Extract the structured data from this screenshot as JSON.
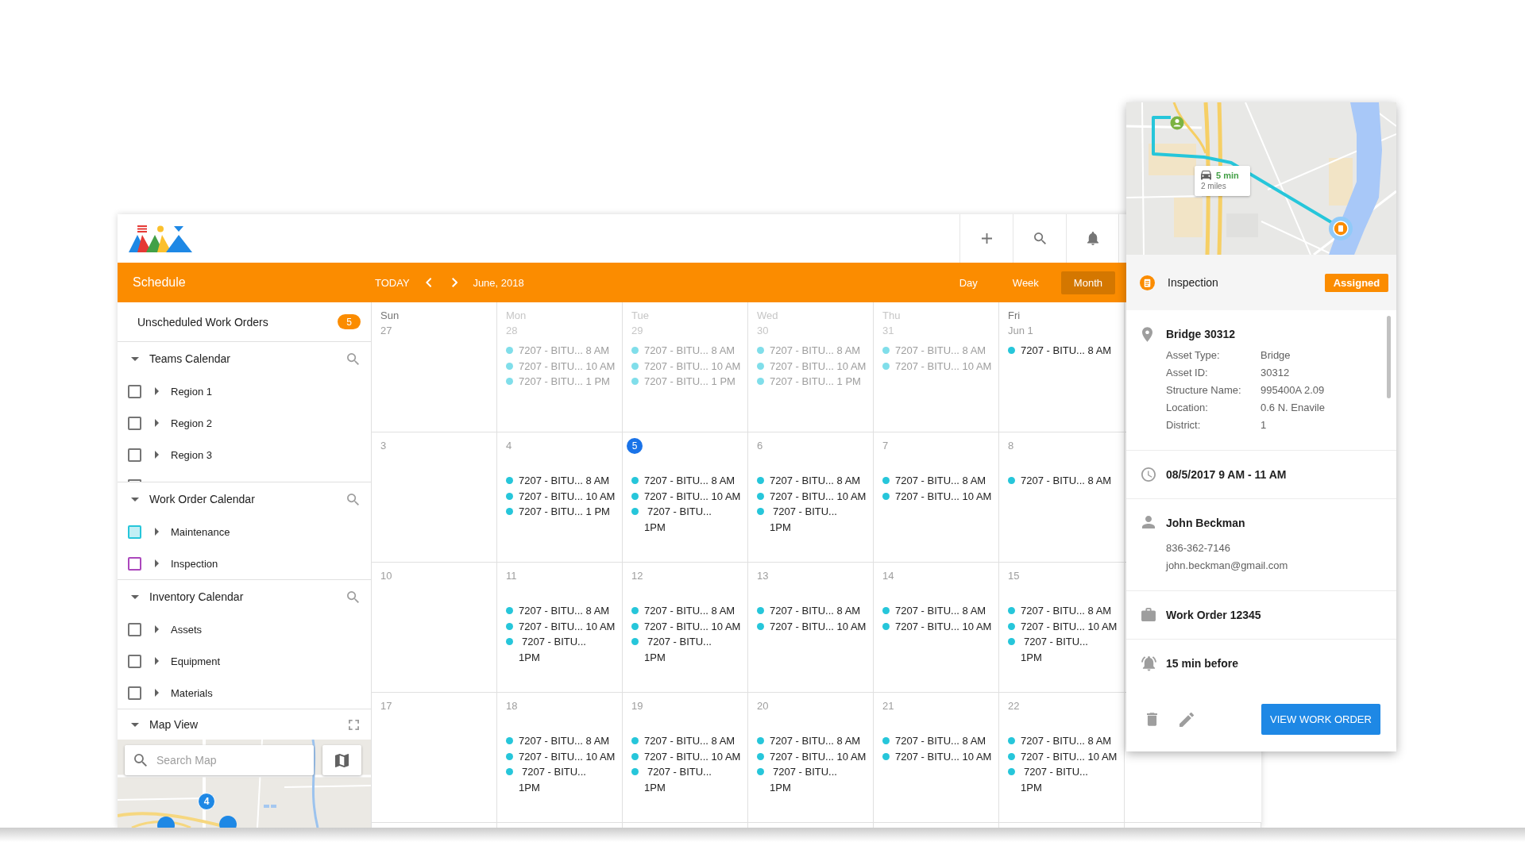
{
  "toolbar": {
    "title": "Schedule",
    "today": "TODAY",
    "period": "June, 2018",
    "views": [
      {
        "label": "Day",
        "selected": false
      },
      {
        "label": "Week",
        "selected": false
      },
      {
        "label": "Month",
        "selected": true
      }
    ]
  },
  "sidebar": {
    "unscheduled": {
      "label": "Unscheduled Work Orders",
      "count": "5"
    },
    "sections": [
      {
        "title": "Teams Calendar",
        "expanded": true,
        "items": [
          {
            "label": "Region 1",
            "checked": false,
            "expanded": false
          },
          {
            "label": "Region 2",
            "checked": false,
            "expanded": false
          },
          {
            "label": "Region 3",
            "checked": false,
            "expanded": false
          },
          {
            "checked": false
          }
        ]
      },
      {
        "title": "Work Order Calendar",
        "expanded": true,
        "items": [
          {
            "label": "Maintenance",
            "checked": true,
            "expanded": false,
            "color": "#26c6da"
          },
          {
            "label": "Inspection",
            "checked": false,
            "expanded": false,
            "color": "#ab47bc"
          }
        ]
      },
      {
        "title": "Inventory Calendar",
        "expanded": true,
        "items": [
          {
            "label": "Assets",
            "checked": false,
            "expanded": false
          },
          {
            "label": "Equipment",
            "checked": false,
            "expanded": false
          },
          {
            "label": "Materials",
            "checked": false,
            "expanded": false
          }
        ]
      }
    ],
    "map_view": {
      "title": "Map View",
      "expanded": true,
      "search": {
        "placeholder": "Search Map"
      },
      "markers": [
        {
          "label": "4"
        }
      ]
    }
  },
  "calendar": {
    "weeks": [
      {
        "days": [
          {
            "weekday": "Sun",
            "date": "27",
            "muted": false,
            "today": false
          },
          {
            "weekday": "Mon",
            "date": "28",
            "muted": true,
            "today": false,
            "events": [
              {
                "kind": "inline",
                "title": "7207 - BITU...",
                "time": "8 AM"
              },
              {
                "kind": "inline",
                "title": "7207 - BITU...",
                "time": "10 AM"
              },
              {
                "kind": "inline",
                "title": "7207 - BITU...",
                "time": "1 PM"
              }
            ]
          },
          {
            "weekday": "Tue",
            "date": "29",
            "muted": true,
            "today": false,
            "events": [
              {
                "kind": "inline",
                "title": "7207 - BITU...",
                "time": "8 AM"
              },
              {
                "kind": "inline",
                "title": "7207 - BITU...",
                "time": "10 AM"
              },
              {
                "kind": "inline",
                "title": "7207 - BITU...",
                "time": "1 PM"
              }
            ]
          },
          {
            "weekday": "Wed",
            "date": "30",
            "muted": true,
            "today": false,
            "events": [
              {
                "kind": "inline",
                "title": "7207 - BITU...",
                "time": "8 AM"
              },
              {
                "kind": "inline",
                "title": "7207 - BITU...",
                "time": "10 AM"
              },
              {
                "kind": "inline",
                "title": "7207 - BITU...",
                "time": "1 PM"
              }
            ]
          },
          {
            "weekday": "Thu",
            "date": "31",
            "muted": true,
            "today": false,
            "events": [
              {
                "kind": "inline",
                "title": "7207 - BITU...",
                "time": "8 AM"
              },
              {
                "kind": "inline",
                "title": "7207 - BITU...",
                "time": "10 AM"
              }
            ]
          },
          {
            "weekday": "Fri",
            "date": "Jun 1",
            "muted": false,
            "today": false,
            "events": [
              {
                "kind": "inline",
                "title": "7207 - BITU...",
                "time": "8 AM"
              }
            ]
          }
        ]
      },
      {
        "days": [
          {
            "date": "3",
            "muted": false,
            "today": false
          },
          {
            "date": "4",
            "muted": false,
            "today": false,
            "events": [
              {
                "kind": "inline",
                "title": "7207 - BITU...",
                "time": "8 AM"
              },
              {
                "kind": "inline",
                "title": "7207 - BITU...",
                "time": "10 AM"
              },
              {
                "kind": "inline",
                "title": "7207 - BITU...",
                "time": "1 PM"
              }
            ]
          },
          {
            "date": "5",
            "muted": false,
            "today": true,
            "events": [
              {
                "kind": "inline",
                "title": "7207 - BITU...",
                "time": "8 AM"
              },
              {
                "kind": "inline",
                "title": "7207 - BITU...",
                "time": "10 AM"
              },
              {
                "kind": "wrapped",
                "title": "7207 - BITU...",
                "time": "1PM"
              }
            ]
          },
          {
            "date": "6",
            "muted": false,
            "today": false,
            "events": [
              {
                "kind": "inline",
                "title": "7207 - BITU...",
                "time": "8 AM"
              },
              {
                "kind": "inline",
                "title": "7207 - BITU...",
                "time": "10 AM"
              },
              {
                "kind": "wrapped",
                "title": "7207 - BITU...",
                "time": "1PM"
              }
            ]
          },
          {
            "date": "7",
            "muted": false,
            "today": false,
            "events": [
              {
                "kind": "inline",
                "title": "7207 - BITU...",
                "time": "8 AM"
              },
              {
                "kind": "inline",
                "title": "7207 - BITU...",
                "time": "10 AM"
              }
            ]
          },
          {
            "date": "8",
            "muted": false,
            "today": false,
            "events": [
              {
                "kind": "inline",
                "title": "7207 - BITU...",
                "time": "8 AM"
              }
            ]
          }
        ]
      },
      {
        "days": [
          {
            "date": "10",
            "muted": false,
            "today": false
          },
          {
            "date": "11",
            "muted": false,
            "today": false,
            "events": [
              {
                "kind": "inline",
                "title": "7207 - BITU...",
                "time": "8 AM"
              },
              {
                "kind": "inline",
                "title": "7207 - BITU...",
                "time": "10 AM"
              },
              {
                "kind": "wrapped",
                "title": "7207 - BITU...",
                "time": "1PM"
              }
            ]
          },
          {
            "date": "12",
            "muted": false,
            "today": false,
            "events": [
              {
                "kind": "inline",
                "title": "7207 - BITU...",
                "time": "8 AM"
              },
              {
                "kind": "inline",
                "title": "7207 - BITU...",
                "time": "10 AM"
              },
              {
                "kind": "wrapped",
                "title": "7207 - BITU...",
                "time": "1PM"
              }
            ]
          },
          {
            "date": "13",
            "muted": false,
            "today": false,
            "events": [
              {
                "kind": "inline",
                "title": "7207 - BITU...",
                "time": "8 AM"
              },
              {
                "kind": "inline",
                "title": "7207 - BITU...",
                "time": "10 AM"
              }
            ]
          },
          {
            "date": "14",
            "muted": false,
            "today": false,
            "events": [
              {
                "kind": "inline",
                "title": "7207 - BITU...",
                "time": "8 AM"
              },
              {
                "kind": "inline",
                "title": "7207 - BITU...",
                "time": "10 AM"
              }
            ]
          },
          {
            "date": "15",
            "muted": false,
            "today": false,
            "events": [
              {
                "kind": "inline",
                "title": "7207 - BITU...",
                "time": "8 AM"
              },
              {
                "kind": "inline",
                "title": "7207 - BITU...",
                "time": "10 AM"
              },
              {
                "kind": "wrapped",
                "title": "7207 - BITU...",
                "time": "1PM"
              }
            ]
          }
        ]
      },
      {
        "days": [
          {
            "date": "17",
            "muted": false,
            "today": false
          },
          {
            "date": "18",
            "muted": false,
            "today": false,
            "events": [
              {
                "kind": "inline",
                "title": "7207 - BITU...",
                "time": "8 AM"
              },
              {
                "kind": "inline",
                "title": "7207 - BITU...",
                "time": "10 AM"
              },
              {
                "kind": "wrapped",
                "title": "7207 - BITU...",
                "time": "1PM"
              }
            ]
          },
          {
            "date": "19",
            "muted": false,
            "today": false,
            "events": [
              {
                "kind": "inline",
                "title": "7207 - BITU...",
                "time": "8 AM"
              },
              {
                "kind": "inline",
                "title": "7207 - BITU...",
                "time": "10 AM"
              },
              {
                "kind": "wrapped",
                "title": "7207 - BITU...",
                "time": "1PM"
              }
            ]
          },
          {
            "date": "20",
            "muted": false,
            "today": false,
            "events": [
              {
                "kind": "inline",
                "title": "7207 - BITU...",
                "time": "8 AM"
              },
              {
                "kind": "inline",
                "title": "7207 - BITU...",
                "time": "10 AM"
              },
              {
                "kind": "wrapped",
                "title": "7207 - BITU...",
                "time": "1PM"
              }
            ]
          },
          {
            "date": "21",
            "muted": false,
            "today": false,
            "events": [
              {
                "kind": "inline",
                "title": "7207 - BITU...",
                "time": "8 AM"
              },
              {
                "kind": "inline",
                "title": "7207 - BITU...",
                "time": "10 AM"
              }
            ]
          },
          {
            "date": "22",
            "muted": false,
            "today": false,
            "events": [
              {
                "kind": "inline",
                "title": "7207 - BITU...",
                "time": "8 AM"
              },
              {
                "kind": "inline",
                "title": "7207 - BITU...",
                "time": "10 AM"
              },
              {
                "kind": "wrapped",
                "title": "7207 - BITU...",
                "time": "1PM"
              }
            ]
          }
        ]
      }
    ]
  },
  "detail": {
    "route": {
      "eta": "5 min",
      "distance": "2 miles"
    },
    "type": "Inspection",
    "status": "Assigned",
    "sections": [
      {
        "kind": "location",
        "title": "Bridge 30312",
        "fields": [
          {
            "label": "Asset Type:",
            "value": "Bridge"
          },
          {
            "label": "Asset ID:",
            "value": "30312"
          },
          {
            "label": "Structure Name:",
            "value": "995400A 2.09"
          },
          {
            "label": "Location:",
            "value": "0.6 N. Enavile"
          },
          {
            "label": "District:",
            "value": "1"
          }
        ]
      },
      {
        "kind": "time",
        "title": "08/5/2017 9 AM - 11 AM"
      },
      {
        "kind": "person",
        "title": "John Beckman",
        "lines": [
          "836-362-7146",
          "john.beckman@gmail.com"
        ]
      },
      {
        "kind": "work_order",
        "title": "Work Order 12345"
      },
      {
        "kind": "reminder",
        "title": "15 min before"
      }
    ],
    "action": "VIEW WORK ORDER"
  }
}
